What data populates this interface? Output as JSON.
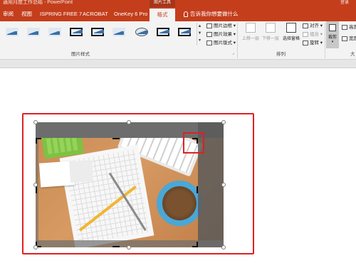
{
  "app": {
    "title": "通用月度工作总结 - PowerPoint",
    "context_tab_title": "图片工具",
    "signin": "登录"
  },
  "tabs": [
    {
      "label": "审阅"
    },
    {
      "label": "视图"
    },
    {
      "label": "ISPRING FREE 7"
    },
    {
      "label": "ACROBAT"
    },
    {
      "label": "OneKey 6 Pro"
    },
    {
      "label": "格式",
      "active": true
    }
  ],
  "tell_me": "告诉我你想要做什么",
  "ribbon": {
    "picture_styles": {
      "label": "图片样式",
      "gallery_icons": [
        "simple-frame-icon",
        "soft-edge-icon",
        "beveled-icon",
        "black-frame-icon",
        "thick-black-frame-icon",
        "shadow-frame-icon",
        "oval-icon",
        "thin-black-frame-icon",
        "metal-frame-icon"
      ],
      "border": "图片边框",
      "effects": "图片效果",
      "layout": "图片版式"
    },
    "arrange": {
      "label": "排列",
      "bring_forward": "上移一层",
      "send_backward": "下移一层",
      "selection_pane": "选择窗格",
      "align": "对齐",
      "group": "组合",
      "rotate": "旋转"
    },
    "size": {
      "crop": "裁剪",
      "height": "高度",
      "width": "宽度",
      "label": "大"
    }
  },
  "colors": {
    "accent": "#c43e1c",
    "highlight": "#e02020"
  }
}
